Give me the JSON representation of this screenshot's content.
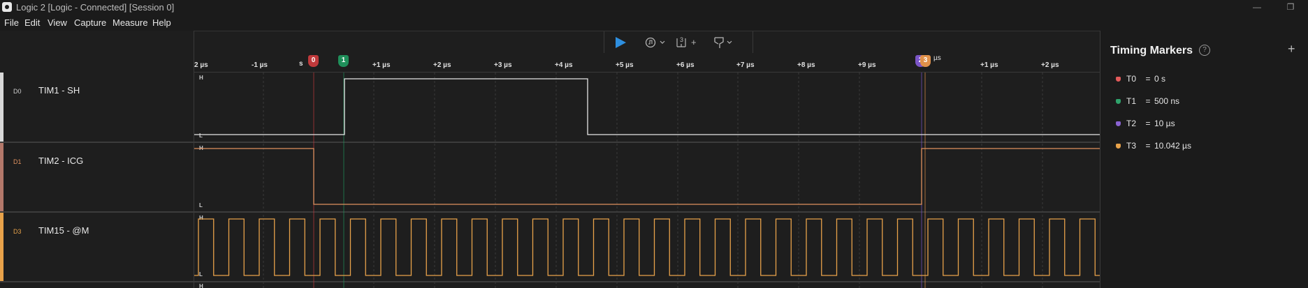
{
  "window": {
    "title": "Logic 2 [Logic - Connected] [Session 0]",
    "minimize_glyph": "—",
    "restore_glyph": "❐"
  },
  "menu": [
    "File",
    "Edit",
    "View",
    "Capture",
    "Measure",
    "Help"
  ],
  "toolbar": {
    "play_icon": "play-icon",
    "trigger_icon": "trigger-icon",
    "measure_icon": "measure-icon",
    "filter_icon": "filter-icon",
    "measure_label": "3",
    "plus": "+"
  },
  "ruler": {
    "ticks": [
      "2 µs",
      "-1 µs",
      "+1 µs",
      "+2 µs",
      "+3 µs",
      "+4 µs",
      "+5 µs",
      "+6 µs",
      "+7 µs",
      "+8 µs",
      "+9 µs",
      "+1 µs",
      "+2 µs"
    ],
    "suffix_0": "s",
    "suffix_3": "µs"
  },
  "markers_on_ruler": [
    {
      "label": "0",
      "color": "#c0393b"
    },
    {
      "label": "1",
      "color": "#1f8f5a"
    },
    {
      "label": "2",
      "color": "#7b55c7"
    },
    {
      "label": "3",
      "color": "#e0914a"
    }
  ],
  "channels": [
    {
      "code": "D0",
      "name": "TIM1 - SH",
      "color": "#d8d8d8",
      "high": "H",
      "low": "L"
    },
    {
      "code": "D1",
      "name": "TIM2 - ICG",
      "color": "#c8876a",
      "high": "H",
      "low": "L"
    },
    {
      "code": "D3",
      "name": "TIM15 - @M",
      "color": "#e8a24a",
      "high": "H",
      "low": "L"
    }
  ],
  "next_channel_high": "H",
  "timing_markers": {
    "title": "Timing Markers",
    "help": "?",
    "add": "+",
    "items": [
      {
        "name": "T0",
        "value": "0 s",
        "color": "#e25a5a"
      },
      {
        "name": "T1",
        "value": "500 ns",
        "color": "#2fa36b"
      },
      {
        "name": "T2",
        "value": "10 µs",
        "color": "#8a63d2"
      },
      {
        "name": "T3",
        "value": "10.042 µs",
        "color": "#e8a24a"
      }
    ],
    "eq": "="
  }
}
